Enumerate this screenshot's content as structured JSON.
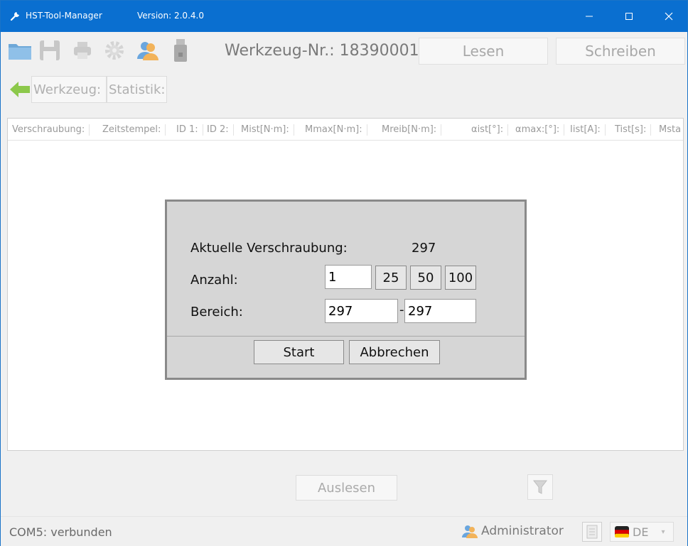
{
  "titlebar": {
    "title": "HST-Tool-Manager",
    "version": "Version: 2.0.4.0",
    "minimize": "—",
    "maximize": "☐",
    "close": "✕"
  },
  "toolbar": {
    "icons": [
      "folder-icon",
      "save-icon",
      "printer-icon",
      "gear-icon",
      "user-icon",
      "usb-icon"
    ],
    "tool_number": "Werkzeug-Nr.: 18390001",
    "read_label": "Lesen",
    "write_label": "Schreiben"
  },
  "nav": {
    "tab_werkzeug": "Werkzeug:",
    "tab_statistik": "Statistik:"
  },
  "grid": {
    "columns": [
      "Verschraubung:",
      "Zeitstempel:",
      "ID 1:",
      "ID 2:",
      "Mist[N·m]:",
      "Mmax[N·m]:",
      "Mreib[N·m]:",
      "αist[°]:",
      "αmax:[°]:",
      "Iist[A]:",
      "Tist[s]:",
      "Msta"
    ]
  },
  "dialog": {
    "current_label": "Aktuelle Verschraubung:",
    "current_value": "297",
    "count_label": "Anzahl:",
    "count_value": "1",
    "preset_25": "25",
    "preset_50": "50",
    "preset_100": "100",
    "range_label": "Bereich:",
    "range_from": "297",
    "range_dash": "-",
    "range_to": "297",
    "start_label": "Start",
    "cancel_label": "Abbrechen"
  },
  "bottom": {
    "read_out_label": "Auslesen"
  },
  "status": {
    "connection": "COM5: verbunden",
    "user": "Administrator",
    "language": "DE"
  },
  "colors": {
    "titlebar": "#0a6fd0",
    "dialog_bg": "#d6d6d6",
    "accent_green": "#8cc84b"
  }
}
